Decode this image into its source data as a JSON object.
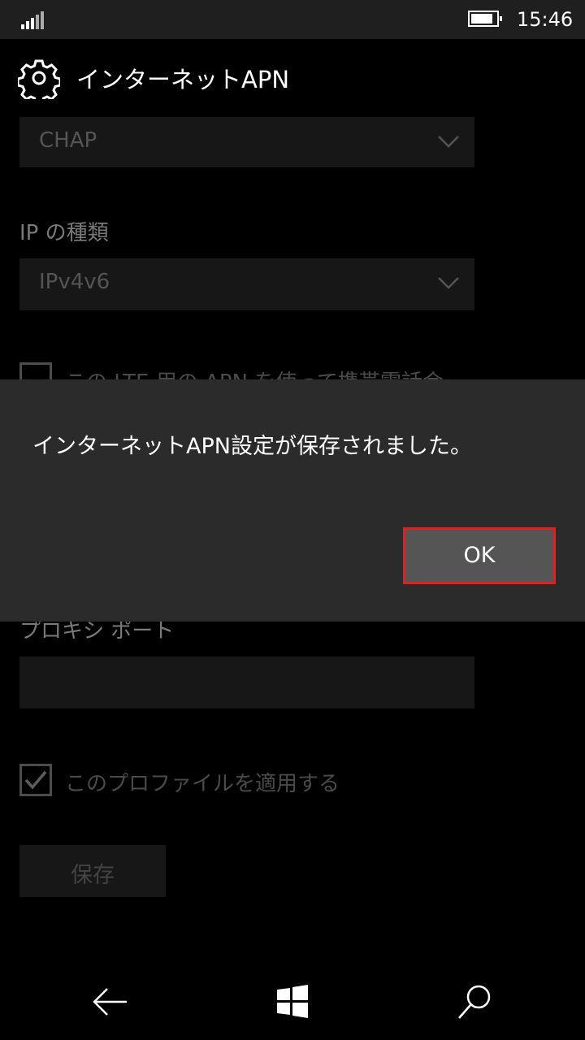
{
  "status_bar": {
    "time": "15:46",
    "signal_icon": "signal-bars-icon",
    "battery_icon": "battery-icon"
  },
  "header": {
    "icon": "gear-icon",
    "title": "インターネットAPN"
  },
  "settings": {
    "auth_type_value": "CHAP",
    "ip_type_label": "IP の種類",
    "ip_type_value": "IPv4v6",
    "lte_checkbox_label": "この LTE 用の APN を使って携帯電話会",
    "proxy_port_label": "プロキシ ポート",
    "proxy_port_value": "",
    "apply_profile_label": "このプロファイルを適用する",
    "apply_profile_checked": true,
    "save_label": "保存"
  },
  "dialog": {
    "message": "インターネットAPN設定が保存されました。",
    "ok_label": "OK",
    "highlight_color": "#e02020"
  },
  "nav_bar": {
    "back_icon": "back-arrow-icon",
    "home_icon": "windows-logo-icon",
    "search_icon": "search-icon"
  }
}
